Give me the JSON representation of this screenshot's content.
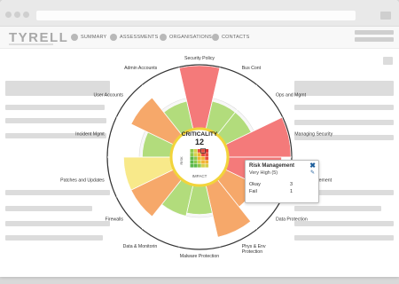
{
  "app": {
    "logo": "TYRELL"
  },
  "nav": {
    "items": [
      "SUMMARY",
      "ASSESSMENTS",
      "ORGANISATIONS",
      "CONTACTS"
    ]
  },
  "colors": {
    "red": "#f47a7a",
    "orange": "#f6a86a",
    "yellow": "#f8e98a",
    "green": "#b2dc7c",
    "dark_ring": "#333333"
  },
  "center": {
    "title": "CRITICALITY",
    "value": "12",
    "y_label": "RISK",
    "x_label": "IMPACT"
  },
  "segments": [
    {
      "label": "Security Policy",
      "level": 1.0,
      "color": "red"
    },
    {
      "label": "Bus Cont",
      "level": 0.45,
      "color": "green"
    },
    {
      "label": "Ops and Mgmt",
      "level": 0.45,
      "color": "green"
    },
    {
      "label": "Managing Security",
      "level": 1.0,
      "color": "red"
    },
    {
      "label": "Risk Management",
      "level": 0.85,
      "color": "red"
    },
    {
      "label": "Data Protection",
      "level": 0.55,
      "color": "orange"
    },
    {
      "label": "Phys & Env Protection",
      "level": 0.85,
      "color": "orange"
    },
    {
      "label": "Malware Protection",
      "level": 0.45,
      "color": "green"
    },
    {
      "label": "Data & Monitorin",
      "level": 0.5,
      "color": "green"
    },
    {
      "label": "Firewalls",
      "level": 0.75,
      "color": "orange"
    },
    {
      "label": "Patches and Updates",
      "level": 0.75,
      "color": "yellow"
    },
    {
      "label": "Incident Mgmt",
      "level": 0.45,
      "color": "green"
    },
    {
      "label": "User Accounts",
      "level": 0.75,
      "color": "orange"
    },
    {
      "label": "Admin Accounts",
      "level": 0.45,
      "color": "green"
    }
  ],
  "popup": {
    "title": "Risk Management",
    "subtitle": "Very High (5)",
    "rows": [
      {
        "label": "Okay",
        "value": "3"
      },
      {
        "label": "Fail",
        "value": "1"
      }
    ]
  },
  "heatmap": [
    [
      "#8cc84b",
      "#d6d04a",
      "#e84a3c",
      "#e84a3c",
      "#d62f2f"
    ],
    [
      "#8cc84b",
      "#d6d04a",
      "#f2b233",
      "#e84a3c",
      "#e84a3c"
    ],
    [
      "#5cb84a",
      "#8cc84b",
      "#f2b233",
      "#f2b233",
      "#e84a3c"
    ],
    [
      "#5cb84a",
      "#8cc84b",
      "#d6d04a",
      "#f2b233",
      "#f2b233"
    ],
    [
      "#5cb84a",
      "#5cb84a",
      "#8cc84b",
      "#d6d04a",
      "#d6d04a"
    ]
  ]
}
